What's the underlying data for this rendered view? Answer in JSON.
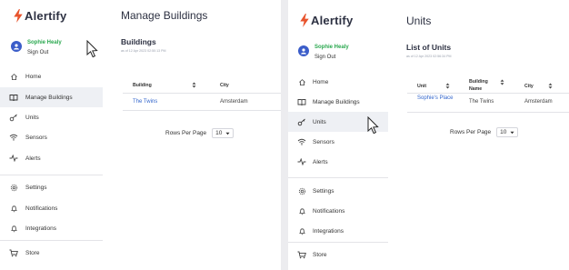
{
  "brand": {
    "name": "Alertify",
    "accent": "#e8542d"
  },
  "user": {
    "name": "Sophie Healy",
    "sign_out": "Sign Out"
  },
  "nav": [
    {
      "label": "Home",
      "icon": "home-icon"
    },
    {
      "label": "Manage Buildings",
      "icon": "book-icon"
    },
    {
      "label": "Units",
      "icon": "key-icon"
    },
    {
      "label": "Sensors",
      "icon": "wifi-icon"
    },
    {
      "label": "Alerts",
      "icon": "activity-icon"
    },
    {
      "label": "Settings",
      "icon": "gear-icon"
    },
    {
      "label": "Notifications",
      "icon": "bell-icon"
    },
    {
      "label": "Integrations",
      "icon": "bell-icon"
    },
    {
      "label": "Store",
      "icon": "cart-icon"
    }
  ],
  "left_screen": {
    "active_nav": "Manage Buildings",
    "page_title": "Manage Buildings",
    "section_title": "Buildings",
    "timestamp": "as of 12 Apr 2023 02:50:13 PM",
    "columns": [
      "Building",
      "City"
    ],
    "rows": [
      {
        "building": "The Twins",
        "city": "Amsterdam"
      }
    ],
    "rows_per_page_label": "Rows Per Page",
    "rows_per_page_value": "10"
  },
  "right_screen": {
    "active_nav": "Units",
    "page_title": "Units",
    "section_title": "List of Units",
    "timestamp": "as of 12 Apr 2023 02:56:34 PM",
    "columns": [
      "Unit",
      "Building Name",
      "City"
    ],
    "rows": [
      {
        "unit": "Sophie's Place",
        "building": "The Twins",
        "city": "Amsterdam"
      }
    ],
    "rows_per_page_label": "Rows Per Page",
    "rows_per_page_value": "10"
  }
}
